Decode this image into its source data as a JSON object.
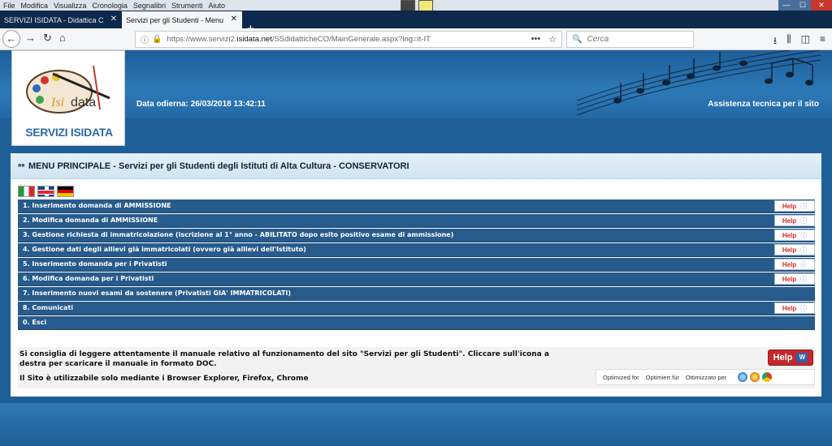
{
  "browser": {
    "menu": [
      "File",
      "Modifica",
      "Visualizza",
      "Cronologia",
      "Segnalibri",
      "Strumenti",
      "Aiuto"
    ],
    "window_controls": {
      "minimize": "—",
      "maximize": "☐",
      "close": "✕"
    },
    "tabs": [
      {
        "title": "SERVIZI ISIDATA - Didattica Conse"
      },
      {
        "title": "Servizi per gli Studenti - Menu princ",
        "active": true
      }
    ],
    "url_prefix": "https://www.servizi2.",
    "url_domain": "isidata.net",
    "url_suffix": "/SSdidatticheCO/MainGenerale.aspx?lng=it-IT",
    "search_placeholder": "Cerca"
  },
  "header": {
    "logo_title": "SERVIZI ISIDATA",
    "date": "Data odierna: 26/03/2018 13:42:11",
    "assistance": "Assistenza tecnica per il sito"
  },
  "panel": {
    "title": "MENU PRINCIPALE - Servizi per gli Studenti degli Istituti di Alta Cultura - CONSERVATORI",
    "flags": [
      "it",
      "uk",
      "de"
    ],
    "help_label": "Help",
    "menu": [
      {
        "label": "1. Inserimento domanda di AMMISSIONE",
        "help": true
      },
      {
        "label": "2. Modifica domanda di AMMISSIONE",
        "help": true
      },
      {
        "label": "3. Gestione richiesta di immatricolazione (iscrizione al 1° anno - ABILITATO dopo esito positivo esame di ammissione)",
        "help": true
      },
      {
        "label": "4. Gestione dati degli allievi già immatricolati (ovvero già allievi dell'Istituto)",
        "help": true
      },
      {
        "label": "5. Inserimento domanda per i Privatisti",
        "help": true
      },
      {
        "label": "6. Modifica domanda per i Privatisti",
        "help": true
      },
      {
        "label": "7. Inserimento nuovi esami da sostenere (Privatisti GIA' IMMATRICOLATI)",
        "help": false
      },
      {
        "label": "8. Comunicati",
        "help": true
      },
      {
        "label": "0. Esci",
        "help": false
      }
    ],
    "notice_text": "Si consiglia di leggere attentamente il manuale relativo al funzionamento del sito \"Servizi per gli Studenti\". Cliccare sull'icona a destra per scaricare il manuale in formato DOC.",
    "browser_note": "Il Sito è utilizzabile solo mediante i Browser Explorer, Firefox, Chrome",
    "big_help_label": "Help",
    "optimized": [
      "Optimized for",
      "Optimiert für",
      "Ottimizzato per"
    ]
  }
}
